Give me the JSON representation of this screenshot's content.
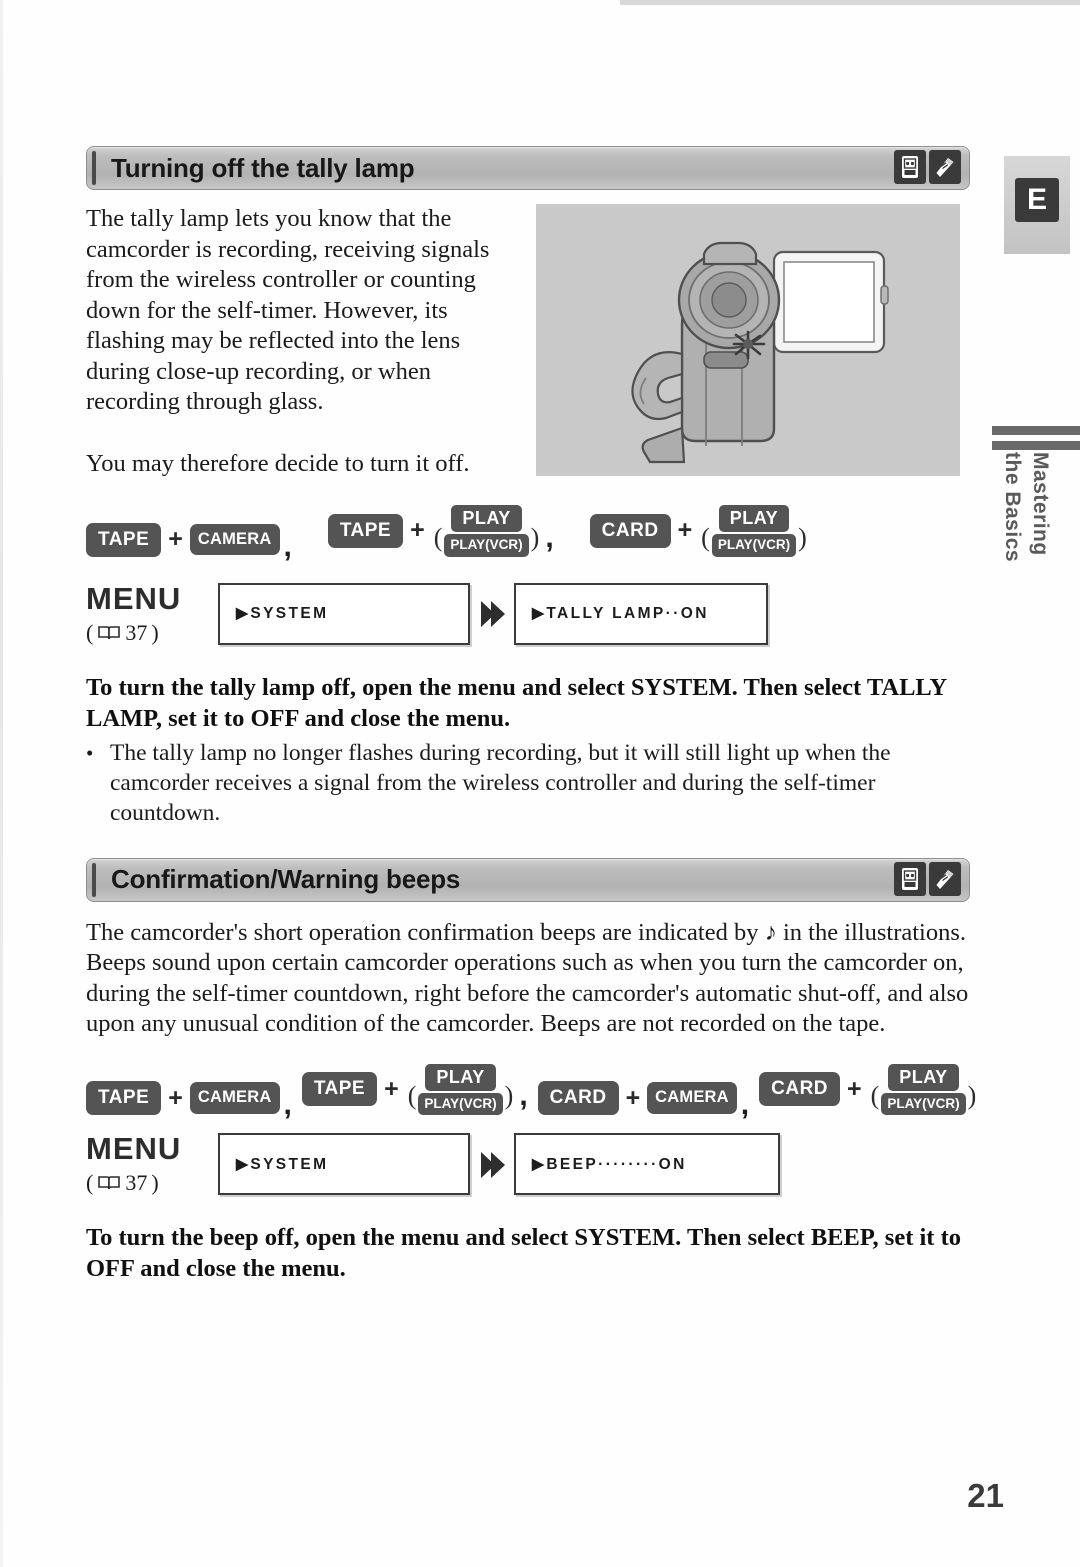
{
  "page": {
    "number": "21",
    "sidebar": {
      "tab_letter": "E",
      "section_line1": "Mastering",
      "section_line2": "the Basics"
    }
  },
  "sections": [
    {
      "id": "tally-lamp",
      "header": {
        "title": "Turning off the tally lamp",
        "icons": [
          "tape-cassette-icon",
          "memory-card-icon"
        ]
      },
      "paragraphs": [
        "The tally lamp lets you know that the camcorder is recording, receiving signals from the wireless controller or counting down for the self-timer. However, its flashing may be reflected into the lens during close-up recording, or when recording through glass.",
        "You may therefore decide to turn it off."
      ],
      "illustration": "camcorder-with-open-lcd-and-flashing-tally-lamp",
      "mode_groups": [
        {
          "first": "TAPE",
          "second": "CAMERA",
          "second_stacked": false,
          "trailing": ","
        },
        {
          "first": "TAPE",
          "second_top": "PLAY",
          "second_bottom": "PLAY(VCR)",
          "second_stacked": true,
          "trailing": ","
        },
        {
          "first": "CARD",
          "second_top": "PLAY",
          "second_bottom": "PLAY(VCR)",
          "second_stacked": true,
          "trailing": ""
        }
      ],
      "menu": {
        "label": "MENU",
        "reference": "37",
        "reference_open": "(",
        "reference_close": ")",
        "step1": "SYSTEM",
        "step2": "TALLY LAMP··ON"
      },
      "instruction": "To turn the tally lamp off, open the menu and select SYSTEM. Then select TALLY LAMP, set it to OFF and close the menu.",
      "bullets": [
        "The tally lamp no longer flashes during recording, but it will still light up when the camcorder receives a signal from the wireless controller and during the self-timer countdown."
      ]
    },
    {
      "id": "beeps",
      "header": {
        "title": "Confirmation/Warning beeps",
        "icons": [
          "tape-cassette-icon",
          "memory-card-icon"
        ]
      },
      "paragraphs": [
        "The camcorder's short operation confirmation beeps are indicated by ♪ in the illustrations. Beeps sound upon certain camcorder operations such as when you turn the camcorder on, during the self-timer countdown, right before the camcorder's automatic shut-off, and also upon any unusual condition of the camcorder. Beeps are not recorded on the tape."
      ],
      "mode_groups": [
        {
          "first": "TAPE",
          "second": "CAMERA",
          "second_stacked": false,
          "trailing": ","
        },
        {
          "first": "TAPE",
          "second_top": "PLAY",
          "second_bottom": "PLAY(VCR)",
          "second_stacked": true,
          "trailing": ","
        },
        {
          "first": "CARD",
          "second": "CAMERA",
          "second_stacked": false,
          "trailing": ","
        },
        {
          "first": "CARD",
          "second_top": "PLAY",
          "second_bottom": "PLAY(VCR)",
          "second_stacked": true,
          "trailing": ""
        }
      ],
      "menu": {
        "label": "MENU",
        "reference": "37",
        "reference_open": "(",
        "reference_close": ")",
        "step1": "SYSTEM",
        "step2": "BEEP········ON"
      },
      "instruction": "To turn the beep off, open the menu and select SYSTEM. Then select BEEP, set it to OFF and close the menu.",
      "bullets": []
    }
  ],
  "colors": {
    "badge_bg": "#545454",
    "header_bar": "#b8b8b8",
    "illustration_bg": "#c9c9c9",
    "ink": "#1c1c1c"
  }
}
